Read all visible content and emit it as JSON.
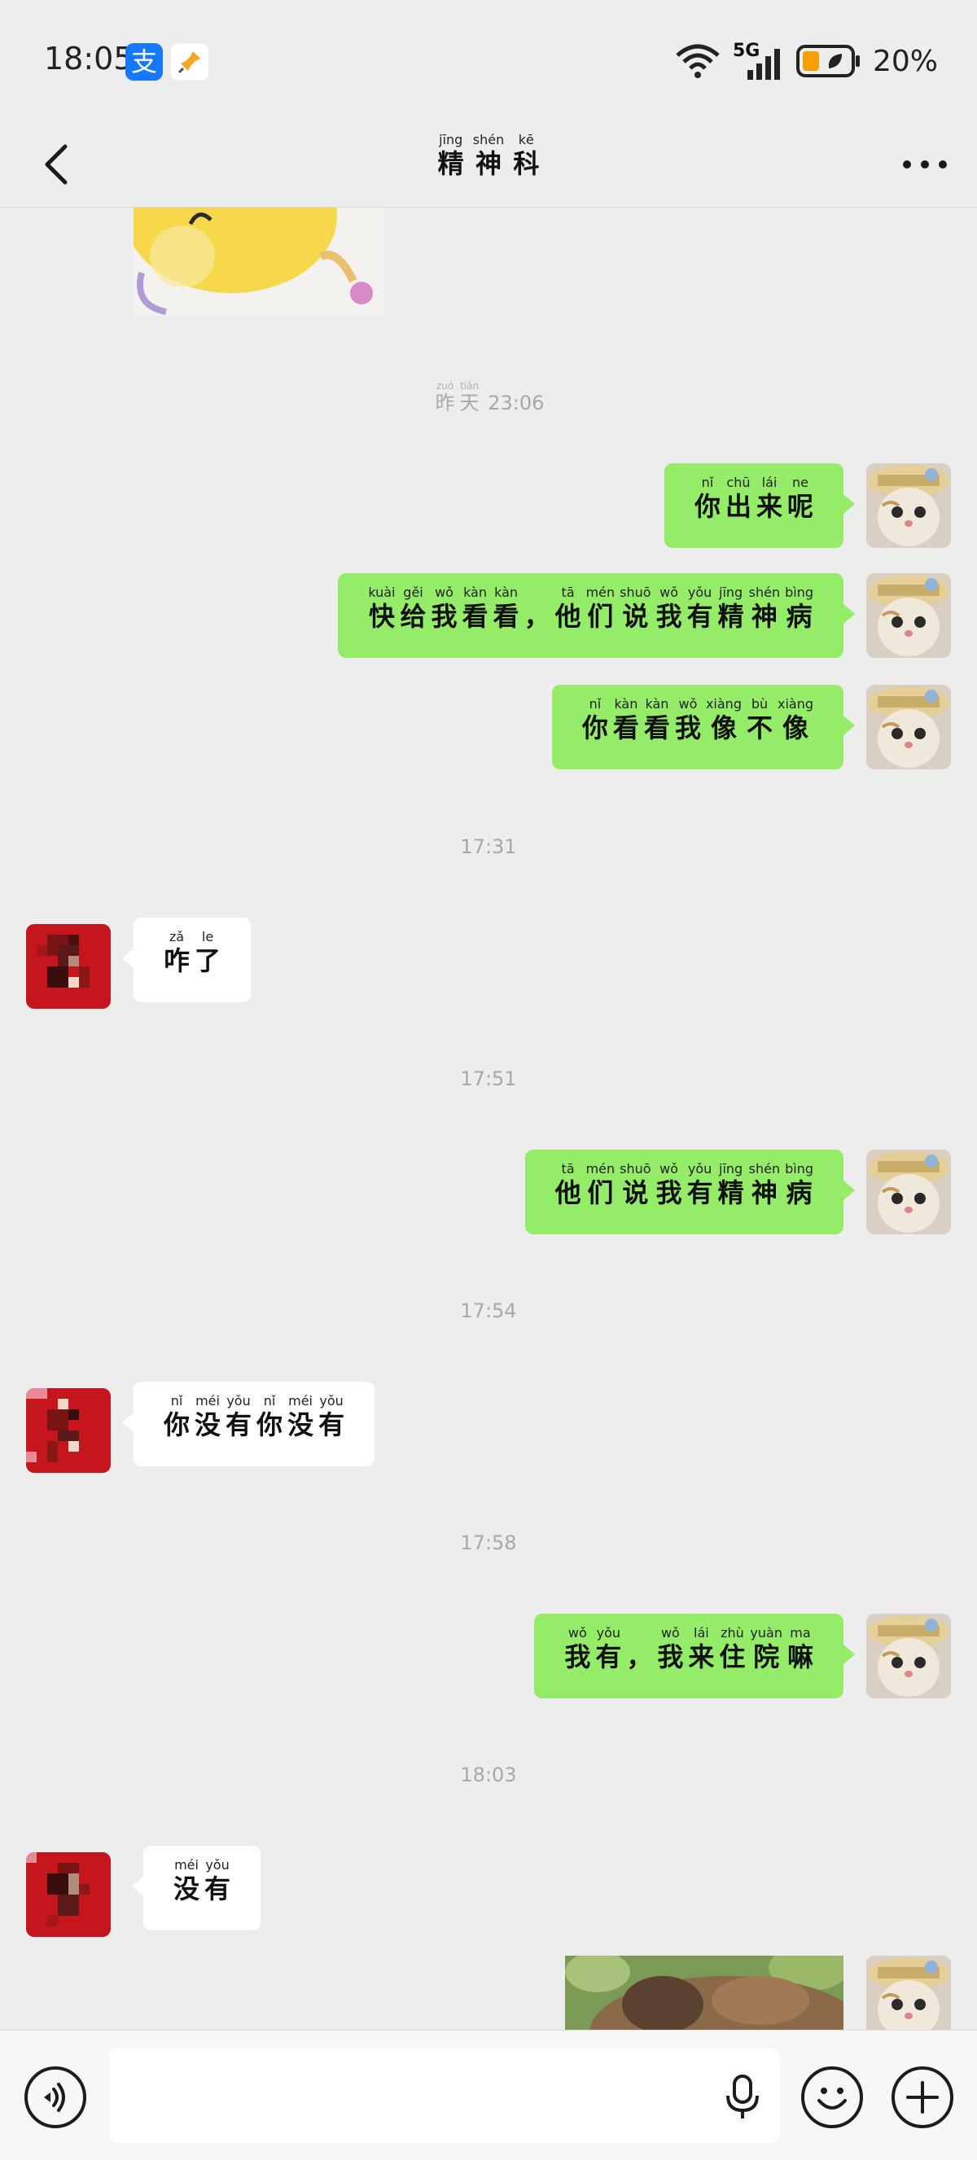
{
  "status_bar": {
    "time": "18:05",
    "alipay_glyph": "支",
    "network": "5G",
    "battery": "20%"
  },
  "header": {
    "title": [
      {
        "py": "jīng",
        "hz": "精"
      },
      {
        "py": "shén",
        "hz": "神"
      },
      {
        "py": "kē",
        "hz": "科"
      }
    ]
  },
  "messages": [
    {
      "type": "timestamp",
      "ruby": [
        {
          "py": "zuó",
          "hz": "昨"
        },
        {
          "py": "tiān",
          "hz": "天"
        }
      ],
      "time": "23:06"
    },
    {
      "type": "text",
      "from": "me",
      "ruby": [
        {
          "py": "nǐ",
          "hz": "你"
        },
        {
          "py": "chū",
          "hz": "出"
        },
        {
          "py": "lái",
          "hz": "来"
        },
        {
          "py": "ne",
          "hz": "呢"
        }
      ]
    },
    {
      "type": "text",
      "from": "me",
      "ruby": [
        {
          "py": "kuài",
          "hz": "快"
        },
        {
          "py": "gěi",
          "hz": "给"
        },
        {
          "py": "wǒ",
          "hz": "我"
        },
        {
          "py": "kàn",
          "hz": "看"
        },
        {
          "py": "kàn",
          "hz": "看"
        },
        {
          "py": "",
          "hz": "，"
        },
        {
          "py": "tā",
          "hz": "他"
        },
        {
          "py": "mén",
          "hz": "们"
        },
        {
          "py": "shuō",
          "hz": "说"
        },
        {
          "py": "wǒ",
          "hz": "我"
        },
        {
          "py": "yǒu",
          "hz": "有"
        },
        {
          "py": "jīng",
          "hz": "精"
        },
        {
          "py": "shén",
          "hz": "神"
        },
        {
          "py": "bìng",
          "hz": "病"
        }
      ]
    },
    {
      "type": "text",
      "from": "me",
      "ruby": [
        {
          "py": "nǐ",
          "hz": "你"
        },
        {
          "py": "kàn",
          "hz": "看"
        },
        {
          "py": "kàn",
          "hz": "看"
        },
        {
          "py": "wǒ",
          "hz": "我"
        },
        {
          "py": "xiàng",
          "hz": "像"
        },
        {
          "py": "bù",
          "hz": "不"
        },
        {
          "py": "xiàng",
          "hz": "像"
        }
      ]
    },
    {
      "type": "timestamp",
      "time": "17:31"
    },
    {
      "type": "text",
      "from": "them",
      "ruby": [
        {
          "py": "zǎ",
          "hz": "咋"
        },
        {
          "py": "le",
          "hz": "了"
        }
      ]
    },
    {
      "type": "timestamp",
      "time": "17:51"
    },
    {
      "type": "text",
      "from": "me",
      "ruby": [
        {
          "py": "tā",
          "hz": "他"
        },
        {
          "py": "mén",
          "hz": "们"
        },
        {
          "py": "shuō",
          "hz": "说"
        },
        {
          "py": "wǒ",
          "hz": "我"
        },
        {
          "py": "yǒu",
          "hz": "有"
        },
        {
          "py": "jīng",
          "hz": "精"
        },
        {
          "py": "shén",
          "hz": "神"
        },
        {
          "py": "bìng",
          "hz": "病"
        }
      ]
    },
    {
      "type": "timestamp",
      "time": "17:54"
    },
    {
      "type": "text",
      "from": "them",
      "ruby": [
        {
          "py": "nǐ",
          "hz": "你"
        },
        {
          "py": "méi",
          "hz": "没"
        },
        {
          "py": "yǒu",
          "hz": "有"
        },
        {
          "py": "nǐ",
          "hz": "你"
        },
        {
          "py": "méi",
          "hz": "没"
        },
        {
          "py": "yǒu",
          "hz": "有"
        }
      ]
    },
    {
      "type": "timestamp",
      "time": "17:58"
    },
    {
      "type": "text",
      "from": "me",
      "ruby": [
        {
          "py": "wǒ",
          "hz": "我"
        },
        {
          "py": "yǒu",
          "hz": "有"
        },
        {
          "py": "",
          "hz": "，"
        },
        {
          "py": "wǒ",
          "hz": "我"
        },
        {
          "py": "lái",
          "hz": "来"
        },
        {
          "py": "zhù",
          "hz": "住"
        },
        {
          "py": "yuàn",
          "hz": "院"
        },
        {
          "py": "ma",
          "hz": "嘛"
        }
      ]
    },
    {
      "type": "timestamp",
      "time": "18:03"
    },
    {
      "type": "text",
      "from": "them",
      "ruby": [
        {
          "py": "méi",
          "hz": "没"
        },
        {
          "py": "yǒu",
          "hz": "有"
        }
      ]
    }
  ],
  "input": {
    "placeholder": ""
  },
  "icons": {
    "back": "chevron-left-icon",
    "more": "more-dots-icon",
    "voice": "voice-icon",
    "mic": "microphone-icon",
    "emoji": "emoji-icon",
    "plus": "plus-icon"
  },
  "colors": {
    "my_bubble": "#95ec69",
    "their_bubble": "#ffffff",
    "background": "#ededed"
  }
}
